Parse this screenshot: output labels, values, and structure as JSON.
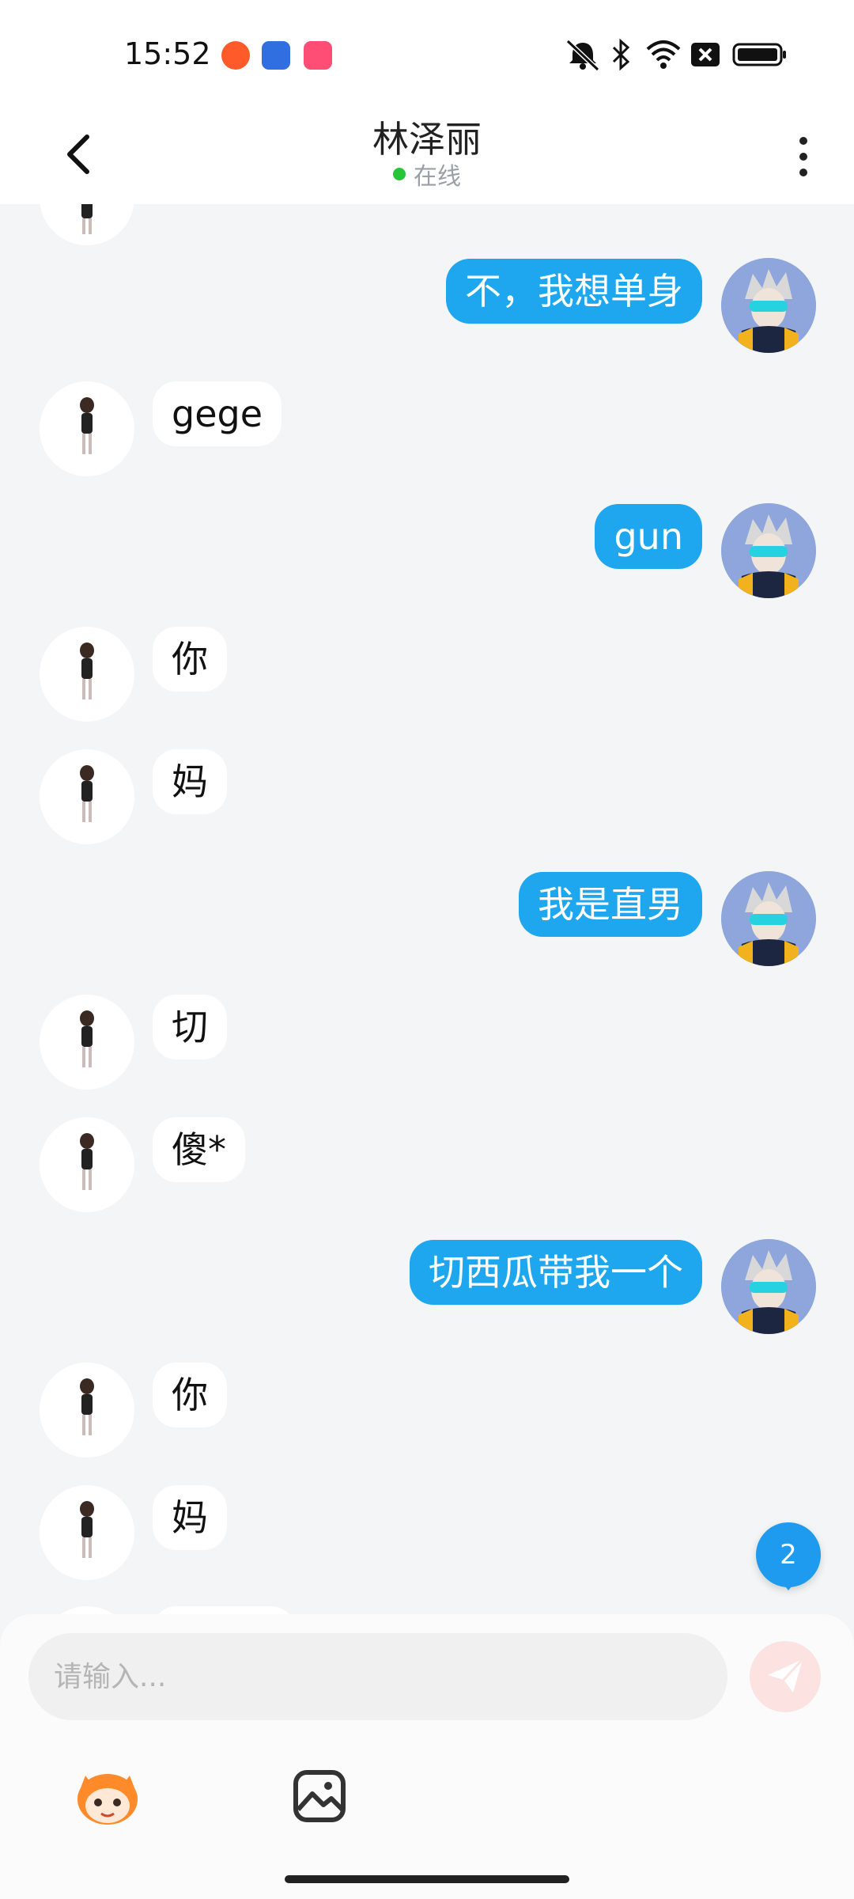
{
  "status_bar": {
    "time": "15:52"
  },
  "header": {
    "title": "林泽丽",
    "presence": "在线",
    "presence_color": "#27c53a"
  },
  "messages": [
    {
      "from": "me",
      "text": "不，我想单身"
    },
    {
      "from": "her",
      "text": "gege"
    },
    {
      "from": "me",
      "text": "gun"
    },
    {
      "from": "her",
      "text": "你"
    },
    {
      "from": "her",
      "text": "妈"
    },
    {
      "from": "me",
      "text": "我是直男"
    },
    {
      "from": "her",
      "text": "切"
    },
    {
      "from": "her",
      "text": "傻*"
    },
    {
      "from": "me",
      "text": "切西瓜带我一个"
    },
    {
      "from": "her",
      "text": "你"
    },
    {
      "from": "her",
      "text": "妈"
    }
  ],
  "unread_badge": "2",
  "composer": {
    "placeholder": "请输入...",
    "send_icon": "send-icon",
    "tools": [
      "mascot-emoji-icon",
      "image-icon"
    ]
  },
  "colors": {
    "outgoing_bubble": "#1ea7ef",
    "incoming_bubble": "#ffffff",
    "chat_background": "#f4f5f7",
    "badge": "#1e9bef"
  }
}
